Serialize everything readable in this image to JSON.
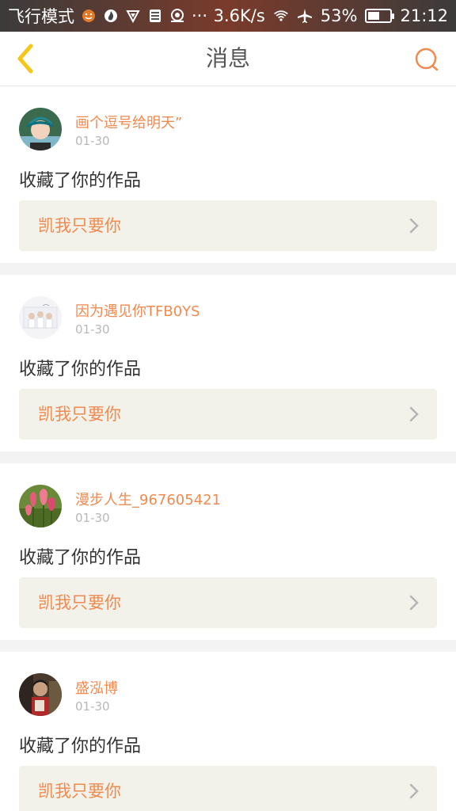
{
  "status_bar": {
    "airplane_mode_text": "飞行模式",
    "net_speed": "3.6K/s",
    "ellipsis": "···",
    "battery_percent": "53%",
    "battery_level": 0.53,
    "time": "21:12",
    "icons": [
      "emoji-icon",
      "fire-icon",
      "shield-icon",
      "sim-icon",
      "location-icon",
      "wifi-icon",
      "airplane-icon",
      "battery-icon"
    ]
  },
  "header": {
    "title": "消息",
    "back_icon": "chevron-left-icon",
    "search_icon": "search-icon"
  },
  "colors": {
    "accent": "#ef8a50",
    "back_icon": "#f5c518",
    "work_box_bg": "#f2f2ea",
    "page_bg": "#f3f3f3"
  },
  "messages": [
    {
      "username": "画个逗号给明天”",
      "date": "01-30",
      "action": "收藏了你的作品",
      "work_title": "凯我只要你",
      "avatar": "avatar-boy-cap"
    },
    {
      "username": "因为遇见你TFB0YS",
      "date": "01-30",
      "action": "收藏了你的作品",
      "work_title": "凯我只要你",
      "avatar": "avatar-group-photo"
    },
    {
      "username": "漫步人生_967605421",
      "date": "01-30",
      "action": "收藏了你的作品",
      "work_title": "凯我只要你",
      "avatar": "avatar-tulips"
    },
    {
      "username": "盛泓博",
      "date": "01-30",
      "action": "收藏了你的作品",
      "work_title": "凯我只要你",
      "avatar": "avatar-person"
    }
  ]
}
